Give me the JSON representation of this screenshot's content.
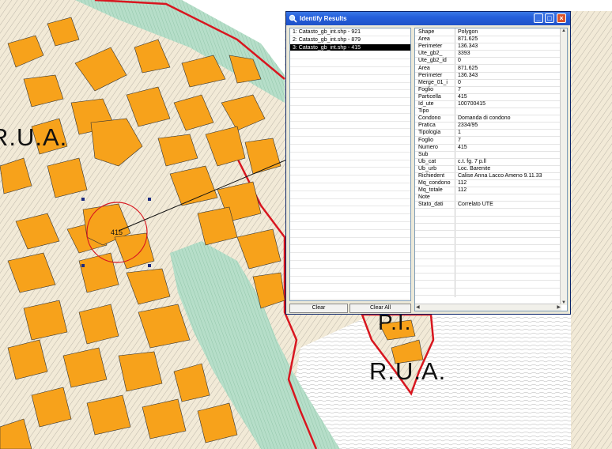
{
  "map": {
    "labels": {
      "rua_top_left": "R.U.A.",
      "pi_right": "P.I.",
      "rua_right": "R.U.A.",
      "parcel_number": "415"
    },
    "colors": {
      "background": "#f2ead7",
      "parcel_fill": "#f7a21b",
      "green_zone": "#a9d8bf",
      "boundary": "#d8161f",
      "selection_circle": "#d8161f",
      "lines": "#555555"
    }
  },
  "window": {
    "title": "Identify Results",
    "buttons": {
      "minimize": "_",
      "maximize": "□",
      "close": "×"
    },
    "results": [
      "1:  Catasto_gb_int.shp - 921",
      "2:  Catasto_gb_int.shp - 879",
      "3:  Catasto_gb_int.shp - 415"
    ],
    "selected_index": 2,
    "clear_label": "Clear",
    "clear_all_label": "Clear All",
    "attributes": [
      {
        "key": "Shape",
        "value": "Polygon"
      },
      {
        "key": "Area",
        "value": "871.625"
      },
      {
        "key": "Perimeter",
        "value": "136.343"
      },
      {
        "key": "Ute_gb2_",
        "value": "3393"
      },
      {
        "key": "Ute_gb2_id",
        "value": "0"
      },
      {
        "key": "Area",
        "value": "871.625"
      },
      {
        "key": "Perimeter",
        "value": "136.343"
      },
      {
        "key": "Merge_01_i",
        "value": "0"
      },
      {
        "key": "Foglio",
        "value": "7"
      },
      {
        "key": "Particella",
        "value": "415"
      },
      {
        "key": "Id_ute",
        "value": "100700415"
      },
      {
        "key": "Tipo",
        "value": ""
      },
      {
        "key": "Condono",
        "value": "Domanda di condono"
      },
      {
        "key": "Pratica",
        "value": "2334/95"
      },
      {
        "key": "Tipologia",
        "value": "1"
      },
      {
        "key": "Foglio",
        "value": "7"
      },
      {
        "key": "Numero",
        "value": "415"
      },
      {
        "key": "Sub",
        "value": ""
      },
      {
        "key": "Ub_cat",
        "value": "c.t. fg. 7   p.ll"
      },
      {
        "key": "Ub_urb",
        "value": "Loc. Barenite"
      },
      {
        "key": "Richiedent",
        "value": "Calise Anna Lacco Ameno 9.11.33"
      },
      {
        "key": "Mq_condono",
        "value": "112"
      },
      {
        "key": "Mq_totale",
        "value": "112"
      },
      {
        "key": "Note",
        "value": ""
      },
      {
        "key": "Stato_dati",
        "value": "Correlato UTE"
      }
    ]
  }
}
